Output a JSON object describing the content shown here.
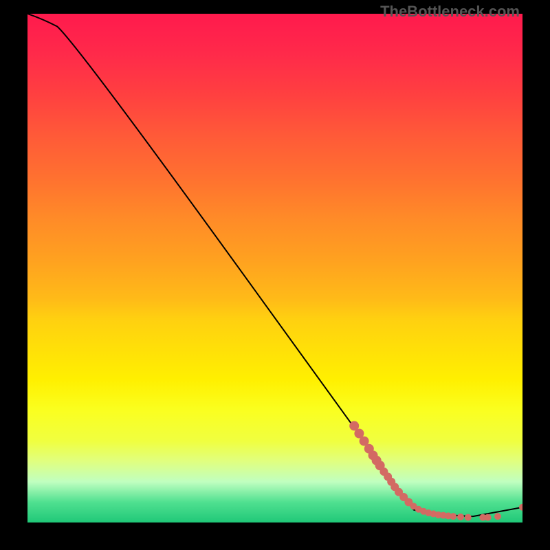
{
  "watermark": "TheBottleneck.com",
  "chart_data": {
    "type": "line",
    "title": "",
    "xlabel": "",
    "ylabel": "",
    "xlim": [
      0,
      100
    ],
    "ylim": [
      0,
      100
    ],
    "curve": [
      {
        "x": 0,
        "y": 100
      },
      {
        "x": 3,
        "y": 99
      },
      {
        "x": 6,
        "y": 97.5
      },
      {
        "x": 10,
        "y": 94
      },
      {
        "x": 78,
        "y": 2.5
      },
      {
        "x": 82,
        "y": 1.5
      },
      {
        "x": 90,
        "y": 1.2
      },
      {
        "x": 100,
        "y": 3
      }
    ],
    "markers": [
      {
        "x": 66,
        "y": 19,
        "size": 7
      },
      {
        "x": 67,
        "y": 17.5,
        "size": 7
      },
      {
        "x": 68,
        "y": 16,
        "size": 7
      },
      {
        "x": 69,
        "y": 14.5,
        "size": 7
      },
      {
        "x": 69.8,
        "y": 13.2,
        "size": 7
      },
      {
        "x": 70.5,
        "y": 12.2,
        "size": 7
      },
      {
        "x": 71.2,
        "y": 11.2,
        "size": 7
      },
      {
        "x": 72,
        "y": 10,
        "size": 6
      },
      {
        "x": 72.8,
        "y": 9,
        "size": 6
      },
      {
        "x": 73.5,
        "y": 8,
        "size": 6
      },
      {
        "x": 74.2,
        "y": 7,
        "size": 6
      },
      {
        "x": 75,
        "y": 6,
        "size": 6
      },
      {
        "x": 76,
        "y": 5,
        "size": 6
      },
      {
        "x": 77,
        "y": 4,
        "size": 6
      },
      {
        "x": 78,
        "y": 3.2,
        "size": 5
      },
      {
        "x": 79,
        "y": 2.6,
        "size": 5
      },
      {
        "x": 80,
        "y": 2.2,
        "size": 5
      },
      {
        "x": 81,
        "y": 1.9,
        "size": 5
      },
      {
        "x": 82,
        "y": 1.7,
        "size": 5
      },
      {
        "x": 83,
        "y": 1.5,
        "size": 5
      },
      {
        "x": 84,
        "y": 1.4,
        "size": 5
      },
      {
        "x": 85,
        "y": 1.3,
        "size": 5
      },
      {
        "x": 86,
        "y": 1.2,
        "size": 5
      },
      {
        "x": 87.5,
        "y": 1.1,
        "size": 5
      },
      {
        "x": 89,
        "y": 1.0,
        "size": 5
      },
      {
        "x": 92,
        "y": 1.0,
        "size": 5
      },
      {
        "x": 93,
        "y": 1.0,
        "size": 5
      },
      {
        "x": 95,
        "y": 1.2,
        "size": 5
      },
      {
        "x": 100,
        "y": 3,
        "size": 5
      }
    ],
    "marker_color": "#d36a63",
    "line_color": "#000000",
    "line_width": 2
  }
}
